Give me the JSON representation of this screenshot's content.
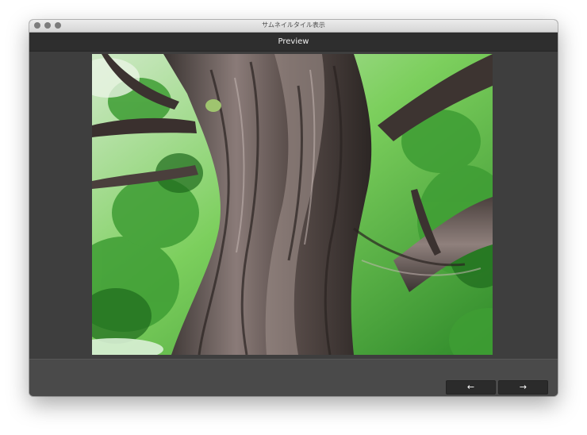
{
  "window": {
    "title": "サムネイルタイル表示"
  },
  "header": {
    "title": "Preview"
  },
  "preview": {
    "subject": "tree-trunk-photo"
  },
  "navigation": {
    "prev_icon": "←",
    "next_icon": "→"
  }
}
